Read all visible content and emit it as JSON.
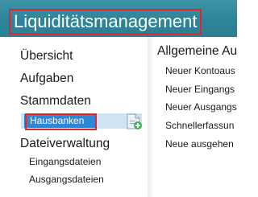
{
  "app": {
    "title": "Liquiditätsmanagement"
  },
  "sidebar": {
    "items": [
      {
        "label": "Übersicht"
      },
      {
        "label": "Aufgaben"
      },
      {
        "label": "Stammdaten"
      },
      {
        "label": "Hausbanken"
      },
      {
        "label": "Dateiverwaltung"
      },
      {
        "label": "Eingangsdateien"
      },
      {
        "label": "Ausgangsdateien"
      }
    ],
    "selected_label": "Hausbanken",
    "add_icon": "add-document-icon"
  },
  "panel": {
    "header": "Allgemeine Au",
    "items": [
      {
        "label": "Neuer Kontoaus"
      },
      {
        "label": "Neuer Eingangs"
      },
      {
        "label": "Neuer Ausgangs"
      },
      {
        "label": "Schnellerfassun"
      },
      {
        "label": "Neue ausgehen"
      }
    ]
  },
  "colors": {
    "titlebar": "#2f8599",
    "selection": "#2d86d6",
    "selection_row": "#cfe4f2",
    "highlight": "#e3262b"
  }
}
